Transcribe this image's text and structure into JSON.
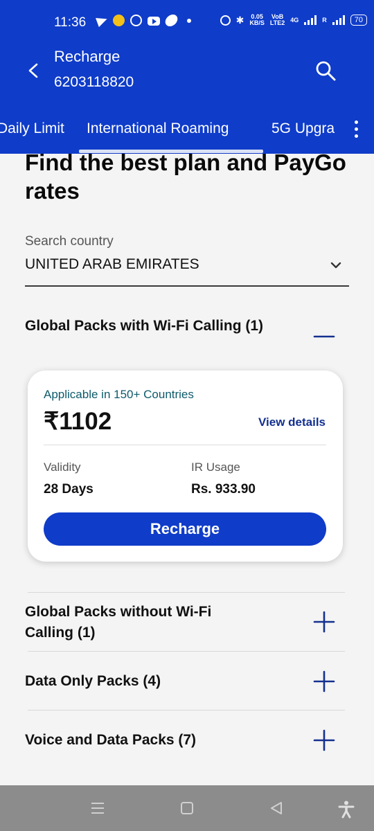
{
  "status_bar": {
    "time": "11:36",
    "speed_top": "0.05",
    "speed_unit": "KB/S",
    "volte_top": "VoB",
    "volte_bottom": "LTE2",
    "network": "4G",
    "roaming": "R",
    "battery": "70"
  },
  "header": {
    "title": "Recharge",
    "subtitle": "6203118820",
    "back_icon": "back-arrow-icon",
    "search_icon": "search-icon"
  },
  "tabs": [
    {
      "label": "Daily Limit"
    },
    {
      "label": "International Roaming"
    },
    {
      "label": "5G Upgra"
    }
  ],
  "page": {
    "heading": "Find the best plan and PayGo rates",
    "search_label": "Search country",
    "country_value": "UNITED ARAB EMIRATES"
  },
  "sections": [
    {
      "title": "Global Packs with Wi-Fi Calling (1)",
      "expanded": true
    },
    {
      "title": "Global Packs without Wi-Fi Calling (1)",
      "expanded": false
    },
    {
      "title": "Data Only Packs (4)",
      "expanded": false
    },
    {
      "title": "Voice and Data Packs (7)",
      "expanded": false
    }
  ],
  "card": {
    "tag": "Applicable in 150+ Countries",
    "price": "₹1102",
    "view_details": "View details",
    "validity_label": "Validity",
    "validity_value": "28 Days",
    "ir_label": "IR Usage",
    "ir_value": "Rs. 933.90",
    "button": "Recharge"
  },
  "colors": {
    "primary": "#0f3cc9",
    "dark_blue": "#13308f",
    "tag_teal": "#0d5a6b",
    "background": "#f4f4f4",
    "navbar": "#8c8c8c"
  }
}
